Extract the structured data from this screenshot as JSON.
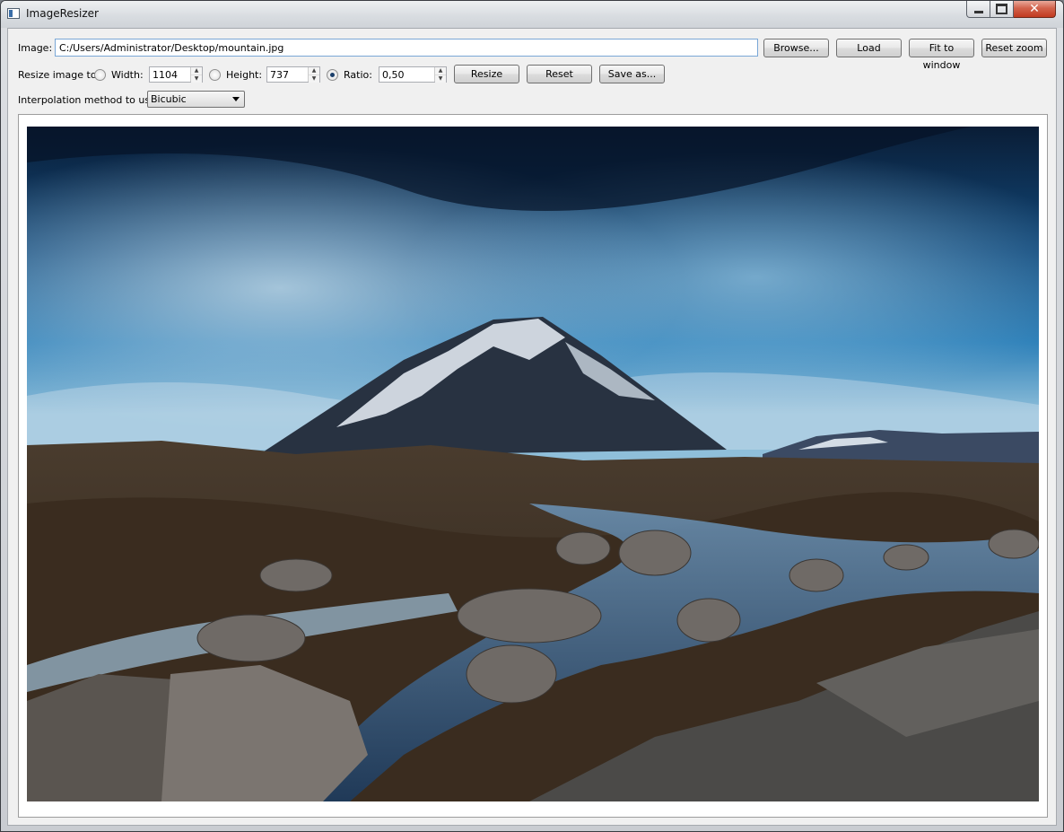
{
  "window": {
    "title": "ImageResizer"
  },
  "image_row": {
    "label": "Image:",
    "path_value": "C:/Users/Administrator/Desktop/mountain.jpg",
    "browse_label": "Browse...",
    "load_label": "Load",
    "fit_label": "Fit to window",
    "reset_zoom_label": "Reset zoom"
  },
  "resize_row": {
    "label": "Resize image to:",
    "width_label": "Width:",
    "width_value": "1104",
    "width_selected": false,
    "height_label": "Height:",
    "height_value": "737",
    "height_selected": false,
    "ratio_label": "Ratio:",
    "ratio_value": "0,50",
    "ratio_selected": true,
    "resize_label": "Resize",
    "reset_label": "Reset",
    "save_label": "Save as..."
  },
  "interp_row": {
    "label": "Interpolation method to use:",
    "selected": "Bicubic"
  },
  "icons": {
    "app": "app-window-icon",
    "minimize": "minimize-icon",
    "maximize": "maximize-icon",
    "close": "close-icon"
  },
  "colors": {
    "input_focus_border": "#7aa7d6",
    "close_button": "#c23a1f"
  }
}
